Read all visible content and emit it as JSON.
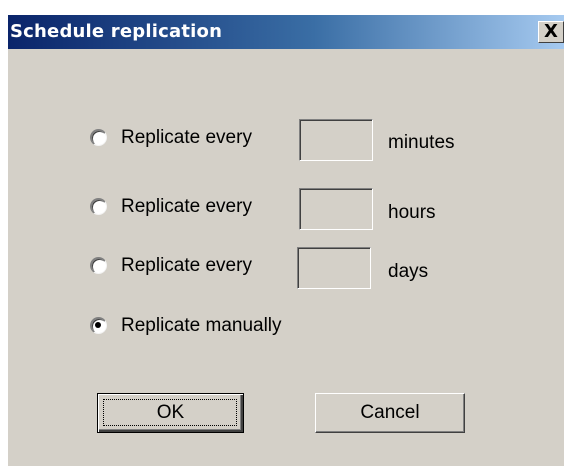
{
  "dialog": {
    "title": "Schedule replication",
    "close_glyph": "X",
    "options": [
      {
        "label": "Replicate every",
        "unit": "minutes",
        "value": "",
        "selected": false
      },
      {
        "label": "Replicate every",
        "unit": "hours",
        "value": "",
        "selected": false
      },
      {
        "label": "Replicate every",
        "unit": "days",
        "value": "",
        "selected": false
      },
      {
        "label": "Replicate manually",
        "selected": true
      }
    ],
    "buttons": {
      "ok_label": "OK",
      "cancel_label": "Cancel"
    }
  },
  "colors": {
    "face": "#d4d0c8",
    "title_start": "#0a246a",
    "title_end": "#a6caf0"
  },
  "icons": {
    "close": "close-icon"
  }
}
